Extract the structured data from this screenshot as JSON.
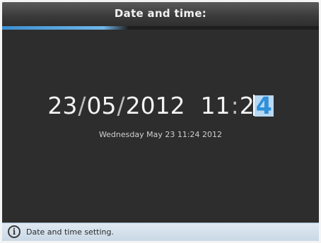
{
  "title": "Date and time:",
  "progress_fraction": 0.4,
  "datetime": {
    "day": "23",
    "sep1": "/",
    "month": "05",
    "sep2": "/",
    "year": "2012",
    "hour": "11",
    "colon": ":",
    "minute_tens": "2",
    "minute_ones": "4"
  },
  "long_datetime": "Wednesday May 23 11:24 2012",
  "status": {
    "icon": "info-icon",
    "icon_glyph": "i",
    "text": "Date and time setting."
  }
}
